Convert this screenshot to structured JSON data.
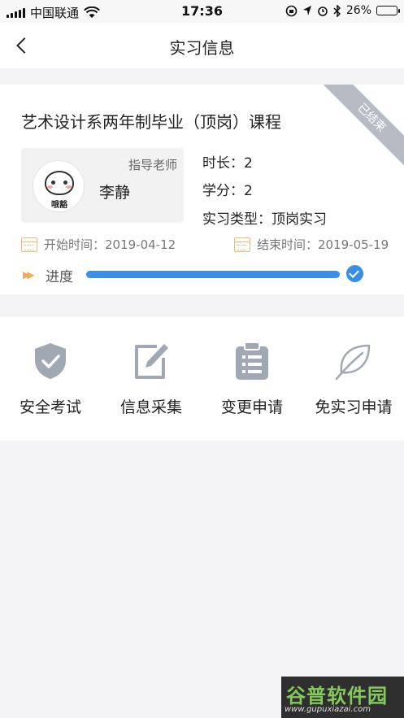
{
  "status_bar": {
    "carrier": "中国联通",
    "time": "17:36",
    "battery": "26%",
    "battery_level": 0.26
  },
  "nav": {
    "title": "实习信息"
  },
  "course": {
    "title": "艺术设计系两年制毕业（顶岗）课程",
    "status_ribbon": "已结束",
    "teacher_role": "指导老师",
    "teacher_name": "李静",
    "avatar_caption": "哦豁",
    "duration": "时长：2",
    "credit": "学分：2",
    "type": "实习类型：顶岗实习",
    "start_label": "开始时间：2019-04-12",
    "end_label": "结束时间：2019-05-19",
    "progress_label": "进度",
    "progress_fraction": 1.0
  },
  "functions": [
    {
      "label": "安全考试",
      "icon": "shield-check-icon"
    },
    {
      "label": "信息采集",
      "icon": "edit-icon"
    },
    {
      "label": "变更申请",
      "icon": "clipboard-icon"
    },
    {
      "label": "免实习申请",
      "icon": "leaf-icon"
    }
  ],
  "colors": {
    "accent": "#3a8ee6",
    "icon_gray": "#a0a8b3",
    "calendar": "#f1b872",
    "ribbon": "#b7bcc4"
  },
  "watermark": {
    "brand": "谷普软件园",
    "url": "www.gupuxiazai.com"
  }
}
